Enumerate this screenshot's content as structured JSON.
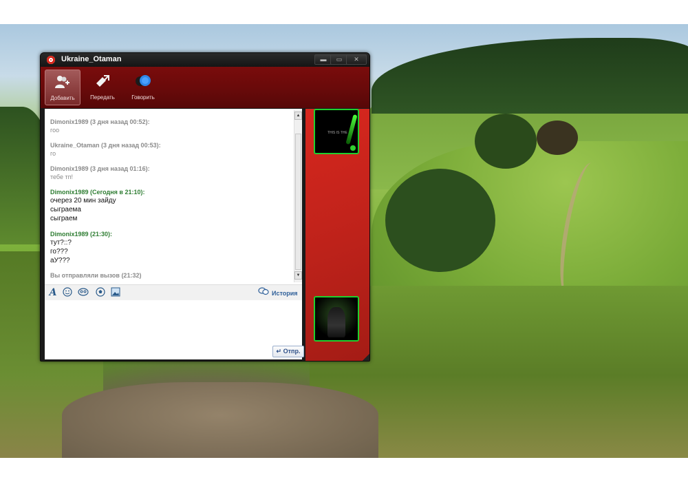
{
  "window": {
    "title": "Ukraine_Otaman",
    "buttons": {
      "minimize": "▬",
      "maximize": "▭",
      "close": "✕"
    }
  },
  "toolbar": {
    "add_label": "Добавить",
    "send_label": "Передать",
    "talk_label": "Говорить"
  },
  "messages": [
    {
      "head": "Dimonix1989  (3 дня назад 00:52):",
      "lines": [
        "гоо"
      ],
      "today": false
    },
    {
      "head": "Ukraine_Otaman  (3 дня назад 00:53):",
      "lines": [
        "го"
      ],
      "today": false
    },
    {
      "head": "Dimonix1989  (3 дня назад 01:16):",
      "lines": [
        "тебе тп!"
      ],
      "today": false
    },
    {
      "head": "Dimonix1989  (Сегодня в 21:10):",
      "lines": [
        "очерез 20 мин зайду",
        "сыграема",
        "сыграем"
      ],
      "today": true
    },
    {
      "head": "Dimonix1989  (21:30):",
      "lines": [
        "тут?::?",
        "го???",
        "аУ???"
      ],
      "today": true
    }
  ],
  "system_message": "Вы отправляли вызов (21:32)",
  "format_bar": {
    "font_glyph": "A",
    "history_label": "История"
  },
  "send_button": "Отпр.",
  "avatars": {
    "top_text": "THIS IS THE"
  },
  "icons": {
    "app": "app-logo-icon",
    "add": "add-user-icon",
    "send": "send-file-icon",
    "talk": "voice-chat-icon",
    "smile": "smiley-icon",
    "wink": "wink-icon",
    "ball": "soccer-ball-icon",
    "picture": "picture-icon",
    "history": "history-icon",
    "enter": "enter-arrow-icon"
  },
  "colors": {
    "toolbar": "#6a0a0a",
    "side_panel": "#c2231b",
    "today_header": "#2e7d32",
    "old_message": "#8a8a8a",
    "avatar_border": "#1fcf2e",
    "history_link": "#2e5f99"
  }
}
